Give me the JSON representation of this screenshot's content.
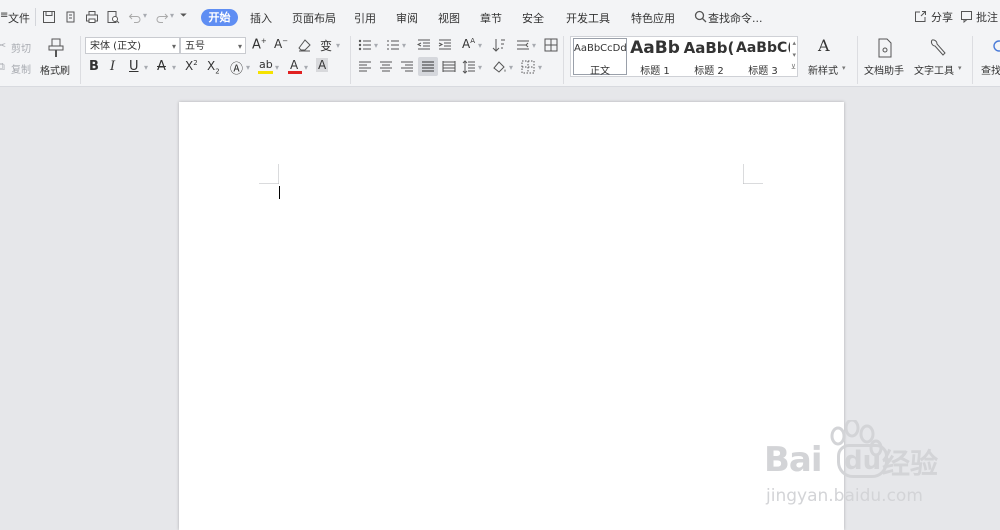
{
  "menubar": {
    "file_label": "文件",
    "tabs": [
      {
        "label": "开始",
        "active": true
      },
      {
        "label": "插入"
      },
      {
        "label": "页面布局"
      },
      {
        "label": "引用"
      },
      {
        "label": "审阅"
      },
      {
        "label": "视图"
      },
      {
        "label": "章节"
      },
      {
        "label": "安全"
      },
      {
        "label": "开发工具"
      },
      {
        "label": "特色应用"
      }
    ],
    "search_placeholder": "查找命令...",
    "share_label": "分享",
    "comment_label": "批注"
  },
  "ribbon": {
    "clipboard": {
      "cut_label": "剪切",
      "copy_label": "复制",
      "format_painter_label": "格式刷"
    },
    "font": {
      "font_name": "宋体 (正文)",
      "font_size": "五号"
    },
    "styles": [
      {
        "preview": "AaBbCcDd",
        "label": "正文",
        "selected": true
      },
      {
        "preview": "AaBb",
        "label": "标题 1"
      },
      {
        "preview": "AaBb(",
        "label": "标题 2"
      },
      {
        "preview": "AaBbC(",
        "label": "标题 3"
      }
    ],
    "new_style_label": "新样式",
    "doc_helper_label": "文档助手",
    "text_tools_label": "文字工具",
    "find_label": "查找"
  },
  "watermark": {
    "brand_prefix": "Bai",
    "brand_suffix": "经验",
    "url": "jingyan.baidu.com"
  },
  "colors": {
    "accent": "#5f8ef3",
    "menubar_bg": "#f3f4f6",
    "workspace_bg": "#e6e7ea",
    "highlight_yellow": "#f5e200",
    "font_color_red": "#e02020"
  }
}
